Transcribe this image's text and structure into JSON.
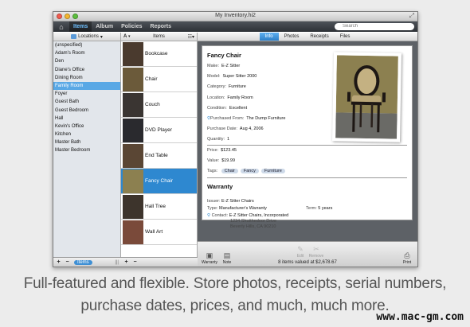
{
  "window": {
    "title": "My Inventory.hi2"
  },
  "nav": {
    "tabs": [
      "Items",
      "Album",
      "Policies",
      "Reports"
    ],
    "active": 0,
    "search_placeholder": "Search"
  },
  "locations": {
    "header": "Locations",
    "items": [
      "(unspecified)",
      "Adam's Room",
      "Den",
      "Diane's Office",
      "Dining Room",
      "Family Room",
      "Foyer",
      "Guest Bath",
      "Guest Bedroom",
      "Hall",
      "Kevin's Office",
      "Kitchen",
      "Master Bath",
      "Master Bedroom"
    ],
    "selected": 5,
    "footer_label": "Items"
  },
  "items": {
    "header": "Items",
    "sort_label": "A",
    "list": [
      "Bookcase",
      "Chair",
      "Couch",
      "DVD Player",
      "End Table",
      "Fancy Chair",
      "Hall Tree",
      "Wall Art"
    ],
    "selected": 5
  },
  "detail": {
    "tabs": [
      "Info",
      "Photos",
      "Receipts",
      "Files"
    ],
    "active_tab": 0,
    "item_title": "Fancy Chair",
    "fields": [
      {
        "label": "Make:",
        "value": "E-Z Sitter"
      },
      {
        "label": "Model:",
        "value": "Super Sitter 2000"
      },
      {
        "label": "Category:",
        "value": "Furniture"
      },
      {
        "label": "Location:",
        "value": "Family Room"
      },
      {
        "label": "Condition:",
        "value": "Excellent"
      },
      {
        "label": "Purchased From:",
        "value": "The Dump Furniture"
      },
      {
        "label": "Purchase Date:",
        "value": "Aug 4, 2006"
      },
      {
        "label": "Quantity:",
        "value": "1"
      },
      {
        "label": "Price:",
        "value": "$123.45"
      },
      {
        "label": "Value:",
        "value": "$19.99"
      }
    ],
    "tags_label": "Tags:",
    "tags": [
      "Chair",
      "Fancy",
      "Furniture"
    ],
    "warranty_title": "Warranty",
    "issuer_label": "Issuer:",
    "issuer": "E-Z Sitter Chairs",
    "type_label": "Type:",
    "type": "Manufacturer's Warranty",
    "term_label": "Term:",
    "term": "5 years",
    "contact_label": "Contact:",
    "contact_lines": [
      "E-Z Sitter Chairs, Incorporated",
      "1234 Shutthedoor Drive",
      "Beverly Hills, CA 90210"
    ]
  },
  "bottom": {
    "warranty": "Warranty",
    "note": "Note",
    "edit": "Edit",
    "remove": "Remove",
    "print": "Print",
    "status": "8 items valued at $2,678.67"
  },
  "caption": {
    "line1": "Full-featured and flexible. Store photos, receipts, serial numbers,",
    "line2": "purchase dates, prices, and much, much more."
  },
  "watermark": "www.mac-gm.com",
  "colors": {
    "accent": "#2e88d0",
    "selection": "#59a8e5",
    "toolbar": "#3a3e43"
  }
}
